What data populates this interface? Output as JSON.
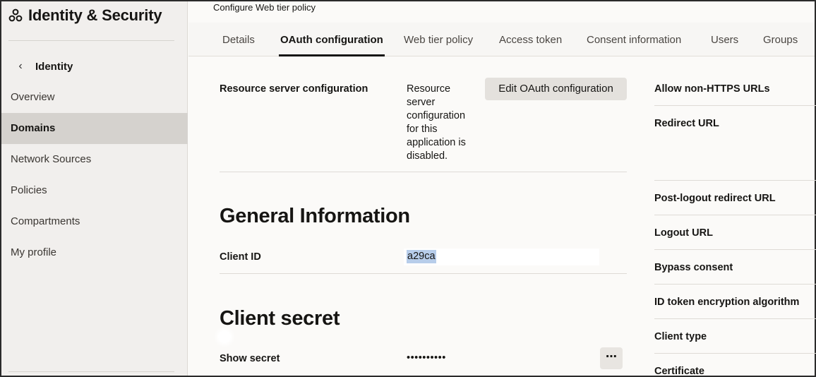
{
  "sidebar": {
    "brand_title": "Identity & Security",
    "back_label": "Identity",
    "items": [
      {
        "label": "Overview",
        "active": false
      },
      {
        "label": "Domains",
        "active": true
      },
      {
        "label": "Network Sources",
        "active": false
      },
      {
        "label": "Policies",
        "active": false
      },
      {
        "label": "Compartments",
        "active": false
      },
      {
        "label": "My profile",
        "active": false
      }
    ]
  },
  "main": {
    "crumb": "Configure Web tier policy",
    "tabs": [
      {
        "label": "Details"
      },
      {
        "label": "OAuth configuration",
        "active": true
      },
      {
        "label": "Web tier policy"
      },
      {
        "label": "Access token"
      },
      {
        "label": "Consent information"
      },
      {
        "label": "Users"
      },
      {
        "label": "Groups"
      }
    ],
    "resource_server": {
      "label": "Resource server configuration",
      "value_lines": [
        "Resource",
        "server",
        "configuration",
        "for this",
        "application is",
        "disabled."
      ],
      "edit_button": "Edit OAuth configuration"
    },
    "general": {
      "heading": "General Information",
      "client_id_label": "Client ID",
      "client_id_value": "a29ca"
    },
    "secret": {
      "heading": "Client secret",
      "show_label": "Show secret",
      "masked_value": "••••••••••",
      "more_label": "⋯"
    },
    "right_column": [
      "Allow non-HTTPS URLs",
      "Redirect URL",
      "Post-logout redirect URL",
      "Logout URL",
      "Bypass consent",
      "ID token encryption algorithm",
      "Client type",
      "Certificate"
    ]
  },
  "colors": {
    "sidebar_bg": "#f1efed",
    "active_nav_bg": "#d5d2ce",
    "highlight": "#b7cdea"
  }
}
